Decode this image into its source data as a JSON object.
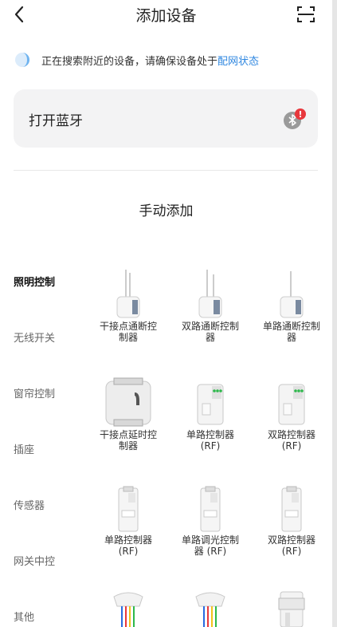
{
  "header": {
    "title": "添加设备",
    "back_icon": "chevron-left-icon",
    "scan_icon": "scan-icon"
  },
  "notice": {
    "text": "正在搜索附近的设备，请确保设备处于",
    "link": "配网状态"
  },
  "bluetooth": {
    "label": "打开蓝牙",
    "icon": "bluetooth-icon",
    "badge": "!"
  },
  "section_title": "手动添加",
  "categories": [
    "照明控制",
    "无线开关",
    "窗帘控制",
    "插座",
    "传感器",
    "网关中控",
    "其他"
  ],
  "devices": [
    {
      "line1": "干接点通断控",
      "line2": "制器"
    },
    {
      "line1": "双路通断控制",
      "line2": "器"
    },
    {
      "line1": "单路通断控制",
      "line2": "器"
    },
    {
      "line1": "干接点延时控",
      "line2": "制器"
    },
    {
      "line1": "单路控制器",
      "line2": "(RF)"
    },
    {
      "line1": "双路控制器",
      "line2": "(RF)"
    },
    {
      "line1": "单路控制器",
      "line2": "(RF)"
    },
    {
      "line1": "单路调光控制",
      "line2": "器 (RF)"
    },
    {
      "line1": "双路控制器",
      "line2": "(RF)"
    }
  ],
  "colors": {
    "accent": "#2f87e0",
    "badge": "#e8383d",
    "card_bg": "#f3f3f4"
  }
}
